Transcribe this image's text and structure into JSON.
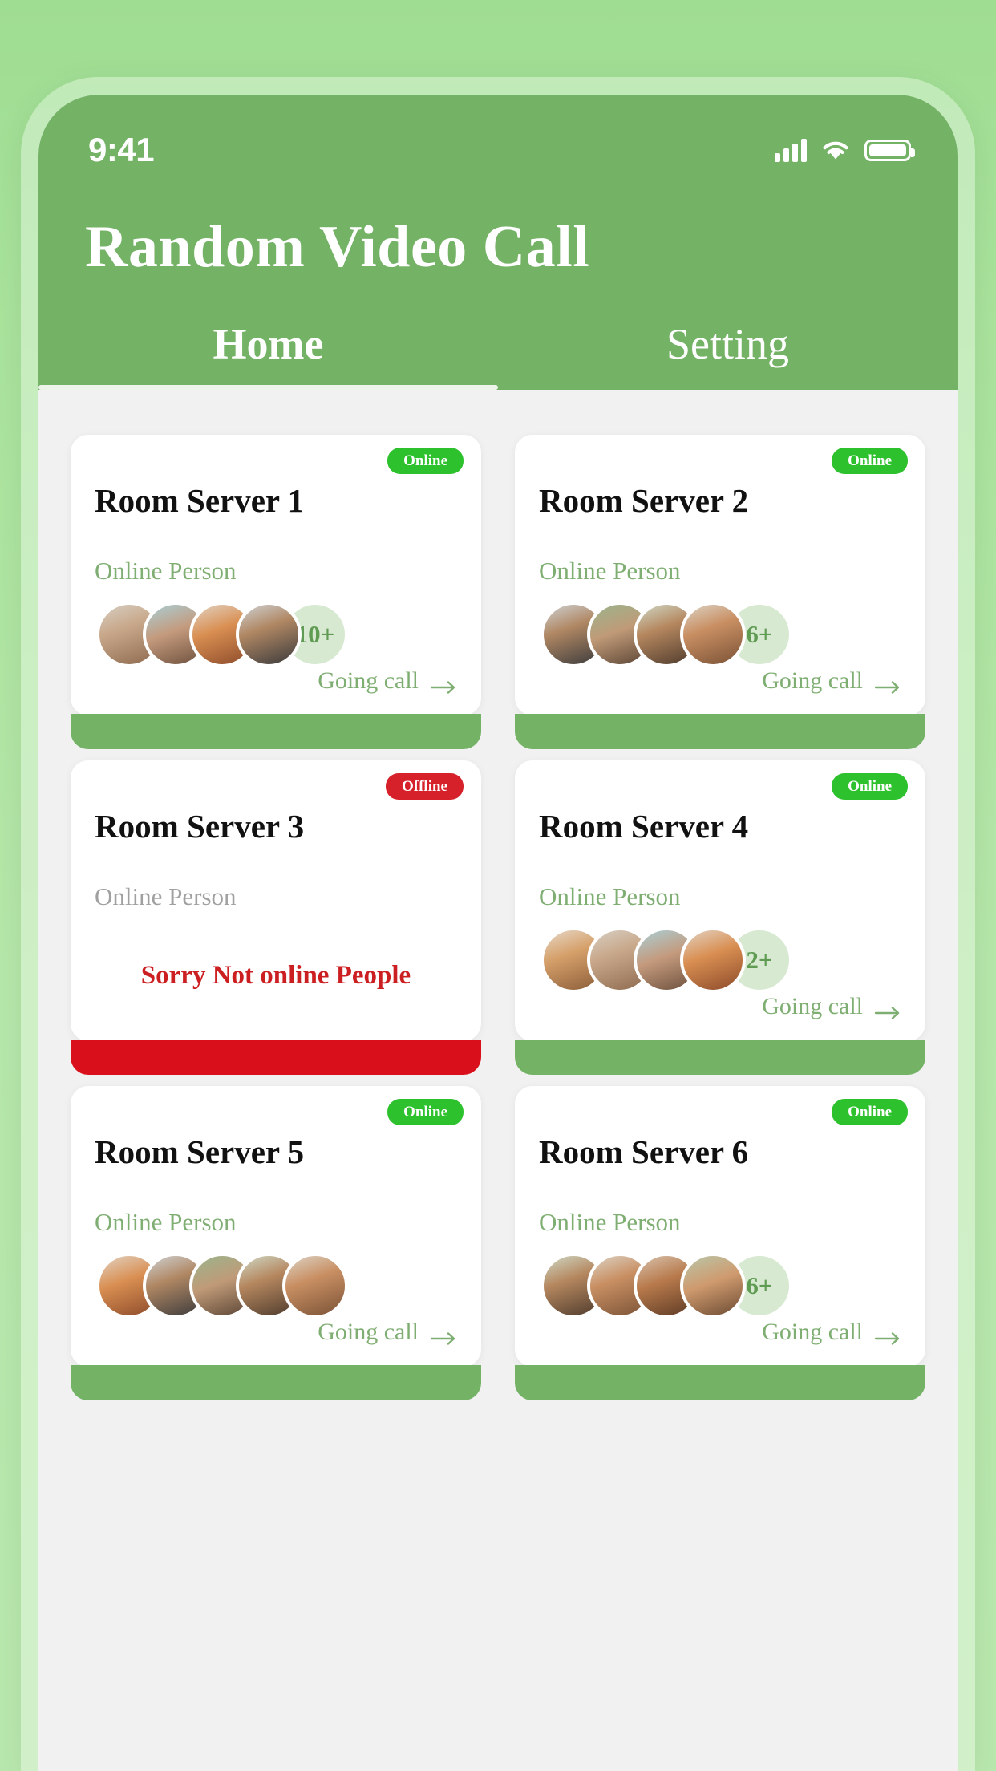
{
  "status_bar": {
    "time": "9:41",
    "icons": [
      "signal-icon",
      "wifi-icon",
      "battery-icon"
    ]
  },
  "header": {
    "title": "Random Video Call",
    "accent_color": "#74b266"
  },
  "tabs": [
    {
      "label": "Home",
      "active": true
    },
    {
      "label": "Setting",
      "active": false
    }
  ],
  "labels": {
    "online_person": "Online Person",
    "going_call": "Going call",
    "offline_message": "Sorry Not online People",
    "badge_online": "Online",
    "badge_offline": "Offline"
  },
  "colors": {
    "online_badge": "#2ec12e",
    "offline_badge": "#d6212a",
    "footer_online": "#74b266",
    "footer_offline": "#d9101c",
    "link_green": "#7fae72",
    "count_bubble": "#d8e9d1",
    "offline_text": "#cc1f22"
  },
  "cards": [
    {
      "title": "Room Server 1",
      "status": "Online",
      "subtitle": "Online Person",
      "avatars": 4,
      "count": "10+",
      "action": "Going call",
      "offline_message": null
    },
    {
      "title": "Room Server 2",
      "status": "Online",
      "subtitle": "Online Person",
      "avatars": 4,
      "count": "6+",
      "action": "Going call",
      "offline_message": null
    },
    {
      "title": "Room Server 3",
      "status": "Offline",
      "subtitle": "Online Person",
      "avatars": 0,
      "count": null,
      "action": null,
      "offline_message": "Sorry Not online People"
    },
    {
      "title": "Room Server 4",
      "status": "Online",
      "subtitle": "Online Person",
      "avatars": 4,
      "count": "2+",
      "action": "Going call",
      "offline_message": null
    },
    {
      "title": "Room Server 5",
      "status": "Online",
      "subtitle": "Online Person",
      "avatars": 5,
      "count": null,
      "action": "Going call",
      "offline_message": null
    },
    {
      "title": "Room Server 6",
      "status": "Online",
      "subtitle": "Online Person",
      "avatars": 4,
      "count": "6+",
      "action": "Going call",
      "offline_message": null
    }
  ]
}
